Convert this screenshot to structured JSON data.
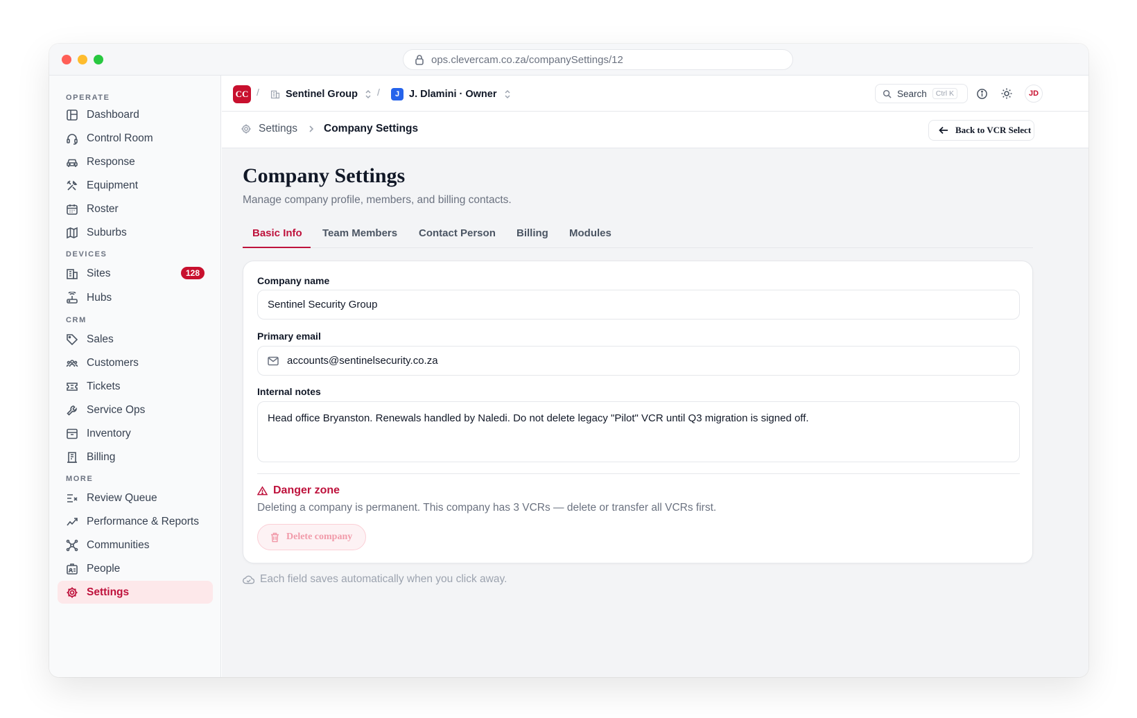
{
  "browser": {
    "url": "ops.clevercam.co.za/companySettings/12"
  },
  "sidebar": {
    "sections": {
      "operate": "OPERATE",
      "devices": "DEVICES",
      "crm": "CRM",
      "more": "MORE"
    },
    "items": {
      "dashboard": "Dashboard",
      "control_room": "Control Room",
      "response": "Response",
      "equipment": "Equipment",
      "roster": "Roster",
      "suburbs": "Suburbs",
      "sites": "Sites",
      "sites_badge": "128",
      "hubs": "Hubs",
      "sales": "Sales",
      "customers": "Customers",
      "tickets": "Tickets",
      "service_ops": "Service Ops",
      "inventory": "Inventory",
      "billing": "Billing",
      "review_queue": "Review Queue",
      "performance_reports": "Performance & Reports",
      "communities": "Communities",
      "people": "People",
      "settings": "Settings"
    }
  },
  "topbar": {
    "logo": "CC",
    "separator": "/",
    "org": "Sentinel Group",
    "user_initial": "J",
    "user": "J. Dlamini · Owner",
    "search_label": "Search",
    "search_shortcut": "Ctrl K",
    "avatar": "JD"
  },
  "pagebar": {
    "crumb_parent": "Settings",
    "crumb_current": "Company Settings",
    "back_label": "Back to VCR Select"
  },
  "page": {
    "title": "Company Settings",
    "subtitle": "Manage company profile, members, and billing contacts."
  },
  "tabs": {
    "basic_info": "Basic Info",
    "team_members": "Team Members",
    "contact_person": "Contact Person",
    "billing": "Billing",
    "modules": "Modules"
  },
  "form": {
    "company_name_label": "Company name",
    "company_name_value": "Sentinel Security Group",
    "email_label": "Primary email",
    "email_value": "accounts@sentinelsecurity.co.za",
    "notes_label": "Internal notes",
    "notes_value": "Head office Bryanston. Renewals handled by Naledi. Do not delete legacy \"Pilot\" VCR until Q3 migration is signed off."
  },
  "danger": {
    "title": "Danger zone",
    "description": "Deleting a company is permanent. This company has 3 VCRs — delete or transfer all VCRs first.",
    "delete_label": "Delete company"
  },
  "footer": {
    "autosave_note": "Each field saves automatically when you click away."
  },
  "colors": {
    "accent": "#be123c",
    "brand": "#c8102e",
    "user_badge": "#2563eb"
  }
}
